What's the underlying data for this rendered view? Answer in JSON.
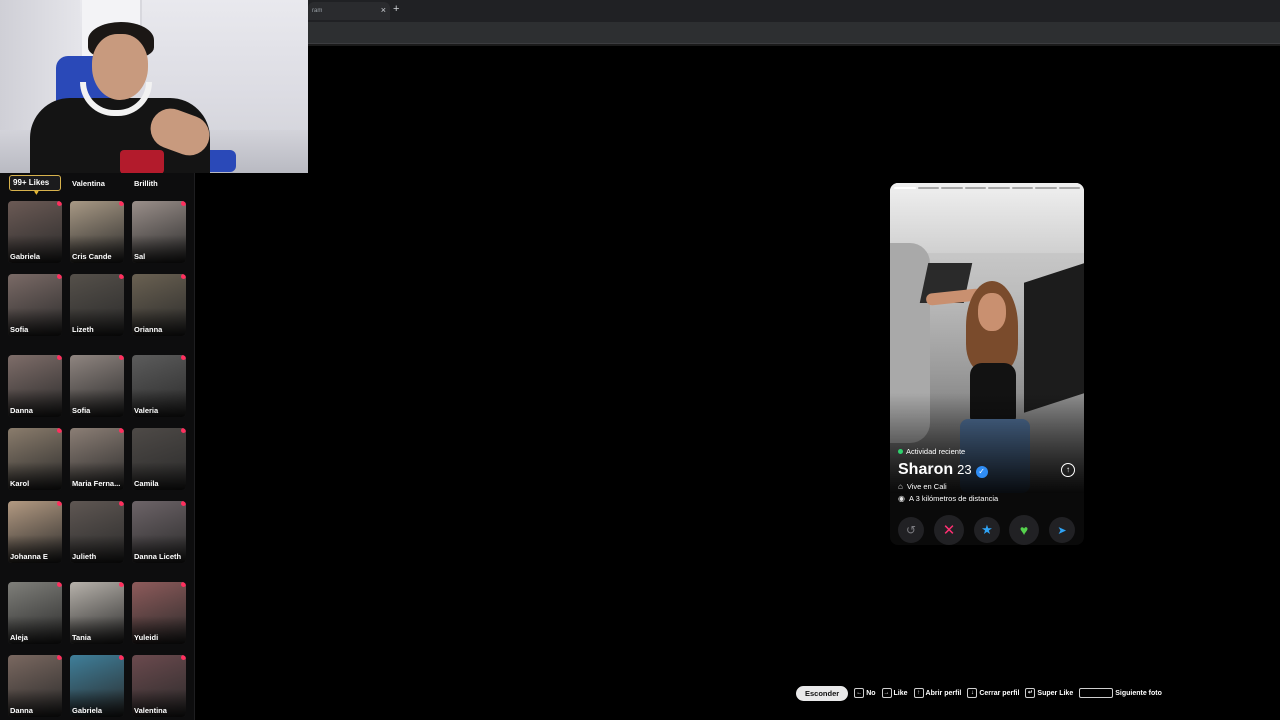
{
  "browser": {
    "tab_title": "ram",
    "tab_close": "×",
    "new_tab": "+"
  },
  "likes": {
    "badge": "99+ Likes",
    "top_names": [
      "Valentina",
      "Brillith"
    ],
    "cards": [
      {
        "name": "Gabriela",
        "tone": "#6b5a55"
      },
      {
        "name": "Cris Cande",
        "tone": "#a89985"
      },
      {
        "name": "Sal",
        "tone": "#9a8f8a"
      },
      {
        "name": "Sofia",
        "tone": "#7a6a66"
      },
      {
        "name": "Lizeth",
        "tone": "#55504a"
      },
      {
        "name": "Orianna",
        "tone": "#6a6152"
      },
      {
        "name": "Danna",
        "tone": "#7e6d69"
      },
      {
        "name": "Sofia",
        "tone": "#8f8580"
      },
      {
        "name": "Valeria",
        "tone": "#5c5c5c"
      },
      {
        "name": "Karol",
        "tone": "#8a7c6c"
      },
      {
        "name": "Maria Ferna...",
        "tone": "#8b7e75"
      },
      {
        "name": "Camila",
        "tone": "#4e4a47"
      },
      {
        "name": "Johanna E",
        "tone": "#b39a82"
      },
      {
        "name": "Julieth",
        "tone": "#5f5753"
      },
      {
        "name": "Danna Liceth",
        "tone": "#6d6468"
      },
      {
        "name": "Aleja",
        "tone": "#7f7f7a"
      },
      {
        "name": "Tania",
        "tone": "#b7b2ab"
      },
      {
        "name": "Yuleidi",
        "tone": "#8e5b5b"
      },
      {
        "name": "Danna",
        "tone": "#7a6860"
      },
      {
        "name": "Gabriela",
        "tone": "#3f7f9a"
      },
      {
        "name": "Valentina",
        "tone": "#6b4a4e"
      }
    ]
  },
  "profile": {
    "activity": "Actividad reciente",
    "name": "Sharon",
    "age": "23",
    "verified_icon": "✓",
    "info_icon": "↑",
    "lives_in": "Vive en Cali",
    "distance": "A 3 kilómetros de distancia",
    "photo_count": 8,
    "active_photo": 1
  },
  "actions": {
    "undo": "↺",
    "nope": "✕",
    "super_like": "★",
    "like": "♥",
    "boost": "➤"
  },
  "shortcuts": {
    "hide": "Esconder",
    "items": [
      {
        "key": "←",
        "label": "No"
      },
      {
        "key": "→",
        "label": "Like"
      },
      {
        "key": "↑",
        "label": "Abrir perfil"
      },
      {
        "key": "↓",
        "label": "Cerrar perfil"
      },
      {
        "key": "↵",
        "label": "Super Like"
      },
      {
        "key": "",
        "label": "Siguiente foto"
      }
    ]
  },
  "colors": {
    "accent_nope": "#ff2f72",
    "accent_like": "#55d24d",
    "accent_super": "#2fa3f5",
    "notification_dot": "#ff2f5e",
    "online": "#2fd26e"
  }
}
